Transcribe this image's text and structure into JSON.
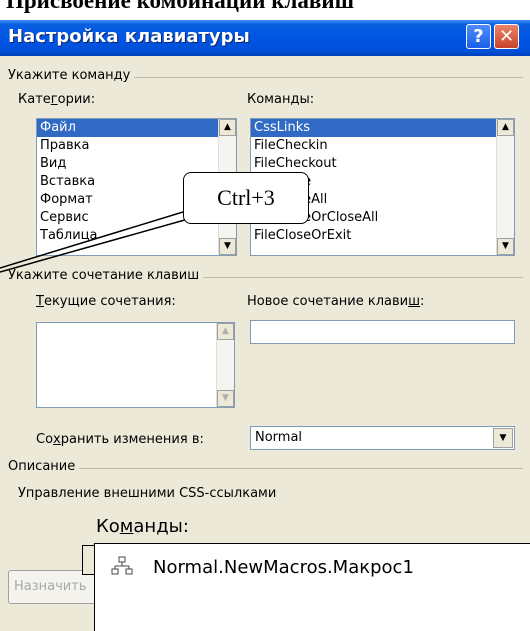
{
  "heading": "Присвоение комбинаций клавиш",
  "window": {
    "title": "Настройка клавиатуры",
    "help_glyph": "?",
    "close_glyph": "✕"
  },
  "command_group": {
    "title": "Укажите команду",
    "categories_label_pre": "Кате",
    "categories_label_key": "г",
    "categories_label_post": "ории:",
    "commands_label_pre": "Коман",
    "commands_label_key": "д",
    "commands_label_post": "ы:",
    "categories": [
      "Файл",
      "Правка",
      "Вид",
      "Вставка",
      "Формат",
      "Сервис",
      "Таблица"
    ],
    "commands": [
      "CssLinks",
      "FileCheckin",
      "FileCheckout",
      "FileClose",
      "FileCloseAll",
      "FileCloseOrCloseAll",
      "FileCloseOrExit"
    ]
  },
  "keys_group": {
    "title": "Укажите сочетание клавиш",
    "current_label_key": "Т",
    "current_label_post": "екущие сочетания:",
    "new_label_pre": "Новое сочетание клави",
    "new_label_key": "ш",
    "new_label_post": ":",
    "new_value": ""
  },
  "save": {
    "label_pre": "Со",
    "label_key": "х",
    "label_post": "ранить изменения в:",
    "value": "Normal"
  },
  "description": {
    "title": "Описание",
    "text": "Управление внешними CSS-ссылками"
  },
  "callout": {
    "text": "Ctrl+3"
  },
  "overlay": {
    "label_pre": "Ко",
    "label_key": "м",
    "label_post": "анды:",
    "item": "Normal.NewMacros.Макрос1",
    "item_icon": "macro-icon"
  },
  "assign_button": "Назначить"
}
